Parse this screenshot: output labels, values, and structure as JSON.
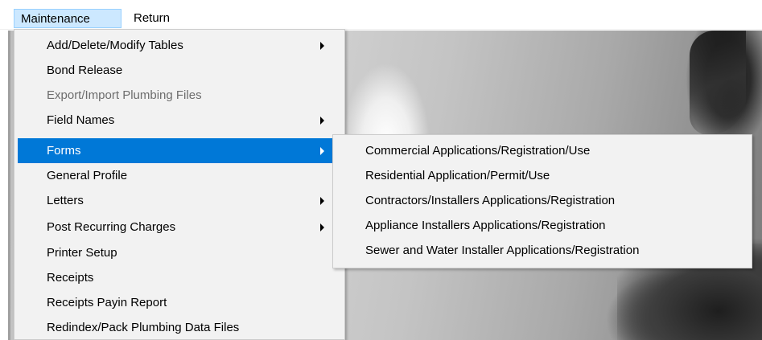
{
  "menubar": {
    "items": [
      {
        "label": "Maintenance",
        "state": "open"
      },
      {
        "label": "Return"
      }
    ]
  },
  "dropdown": {
    "items": [
      {
        "label": "Add/Delete/Modify Tables",
        "submenu": true
      },
      {
        "label": "Bond Release"
      },
      {
        "label": "Export/Import Plumbing Files",
        "disabled": true
      },
      {
        "label": "Field Names",
        "submenu": true
      },
      {
        "label": "Forms",
        "submenu": true,
        "selected": true
      },
      {
        "label": "General Profile"
      },
      {
        "label": "Letters",
        "submenu": true
      },
      {
        "label": "Post Recurring Charges",
        "submenu": true
      },
      {
        "label": "Printer Setup"
      },
      {
        "label": "Receipts"
      },
      {
        "label": "Receipts Payin Report"
      },
      {
        "label": "Redindex/Pack Plumbing Data Files"
      }
    ]
  },
  "forms_submenu": {
    "items": [
      {
        "label": "Commercial  Applications/Registration/Use"
      },
      {
        "label": "Residential Application/Permit/Use"
      },
      {
        "label": "Contractors/Installers Applications/Registration"
      },
      {
        "label": "Appliance Installers Applications/Registration"
      },
      {
        "label": "Sewer and Water Installer Applications/Registration"
      }
    ]
  },
  "colors": {
    "selection": "#0078d7",
    "menubar_open": "#cce8ff",
    "menu_background": "#f2f2f2",
    "disabled_text": "#6d6d6d"
  },
  "icons": {
    "submenu_indicator": "chevron-right-icon"
  }
}
